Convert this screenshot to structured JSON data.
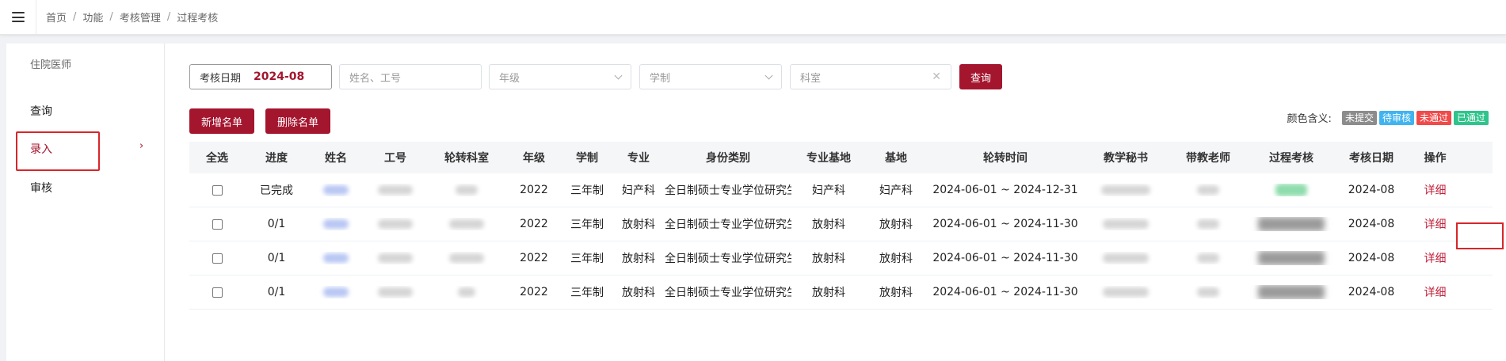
{
  "breadcrumb": [
    "首页",
    "功能",
    "考核管理",
    "过程考核"
  ],
  "sidebar": {
    "title": "住院医师",
    "items": [
      {
        "label": "查询"
      },
      {
        "label": "录入"
      },
      {
        "label": "审核"
      }
    ]
  },
  "filters": {
    "date_label": "考核日期",
    "date_value": "2024-08",
    "name_placeholder": "姓名、工号",
    "grade_placeholder": "年级",
    "system_placeholder": "学制",
    "dept_placeholder": "科室"
  },
  "buttons": {
    "query": "查询",
    "add": "新增名单",
    "delete": "删除名单"
  },
  "legend": {
    "label": "颜色含义:",
    "tags": [
      {
        "text": "未提交",
        "color": "#8c8c8c"
      },
      {
        "text": "待审核",
        "color": "#41b4f0"
      },
      {
        "text": "未通过",
        "color": "#f04a4a"
      },
      {
        "text": "已通过",
        "color": "#2fc48c"
      }
    ]
  },
  "table": {
    "headers": [
      "全选",
      "进度",
      "姓名",
      "工号",
      "轮转科室",
      "年级",
      "学制",
      "专业",
      "身份类别",
      "专业基地",
      "基地",
      "轮转时间",
      "教学秘书",
      "带教老师",
      "过程考核",
      "考核日期",
      "操作"
    ],
    "rows": [
      {
        "progress": "已完成",
        "grade": "2022",
        "system": "三年制",
        "major": "妇产科",
        "identity": "全日制硕士专业学位研究生",
        "major_base": "妇产科",
        "base": "妇产科",
        "period": "2024-06-01 ~ 2024-12-31",
        "date": "2024-08",
        "action": "详细",
        "status": "green"
      },
      {
        "progress": "0/1",
        "grade": "2022",
        "system": "三年制",
        "major": "放射科",
        "identity": "全日制硕士专业学位研究生",
        "major_base": "放射科",
        "base": "放射科",
        "period": "2024-06-01 ~ 2024-11-30",
        "date": "2024-08",
        "action": "详细",
        "status": "dark"
      },
      {
        "progress": "0/1",
        "grade": "2022",
        "system": "三年制",
        "major": "放射科",
        "identity": "全日制硕士专业学位研究生",
        "major_base": "放射科",
        "base": "放射科",
        "period": "2024-06-01 ~ 2024-11-30",
        "date": "2024-08",
        "action": "详细",
        "status": "dark"
      },
      {
        "progress": "0/1",
        "grade": "2022",
        "system": "三年制",
        "major": "放射科",
        "identity": "全日制硕士专业学位研究生",
        "major_base": "放射科",
        "base": "放射科",
        "period": "2024-06-01 ~ 2024-11-30",
        "date": "2024-08",
        "action": "详细",
        "status": "dark"
      }
    ]
  }
}
